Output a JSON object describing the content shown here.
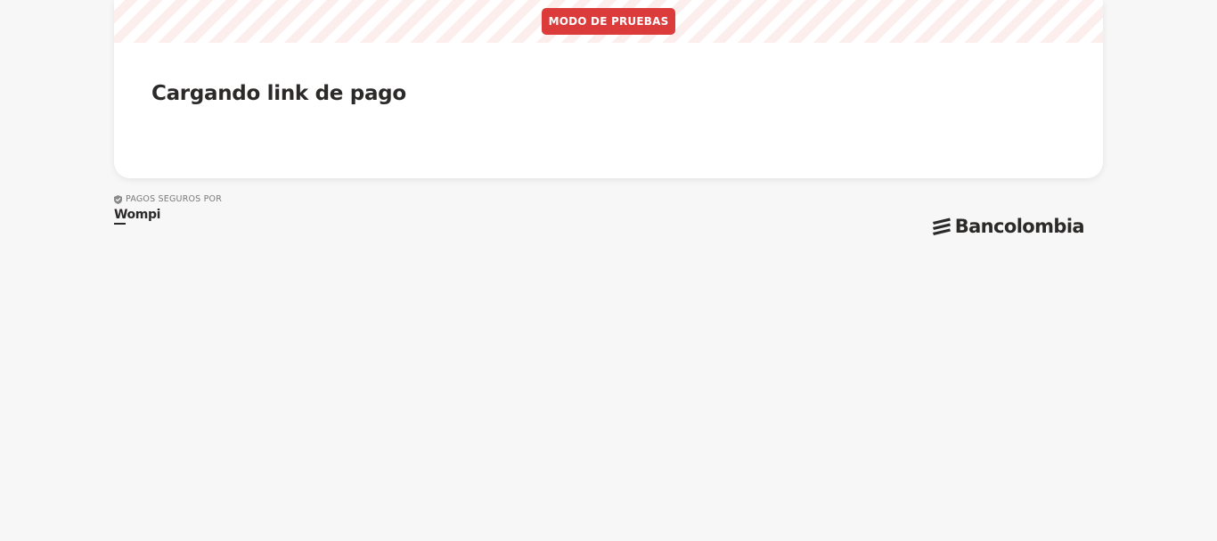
{
  "banner": {
    "label": "MODO DE PRUEBAS",
    "color": "#db3b3b",
    "stripe_color": "#fdeeee"
  },
  "card": {
    "title": "Cargando link de pago"
  },
  "footer": {
    "secure_text": "PAGOS SEGUROS POR",
    "secure_icon": "shield-check-icon",
    "provider_logo": "Wompi",
    "bank_logo": "Bancolombia",
    "bank_icon": "bancolombia-icon"
  }
}
